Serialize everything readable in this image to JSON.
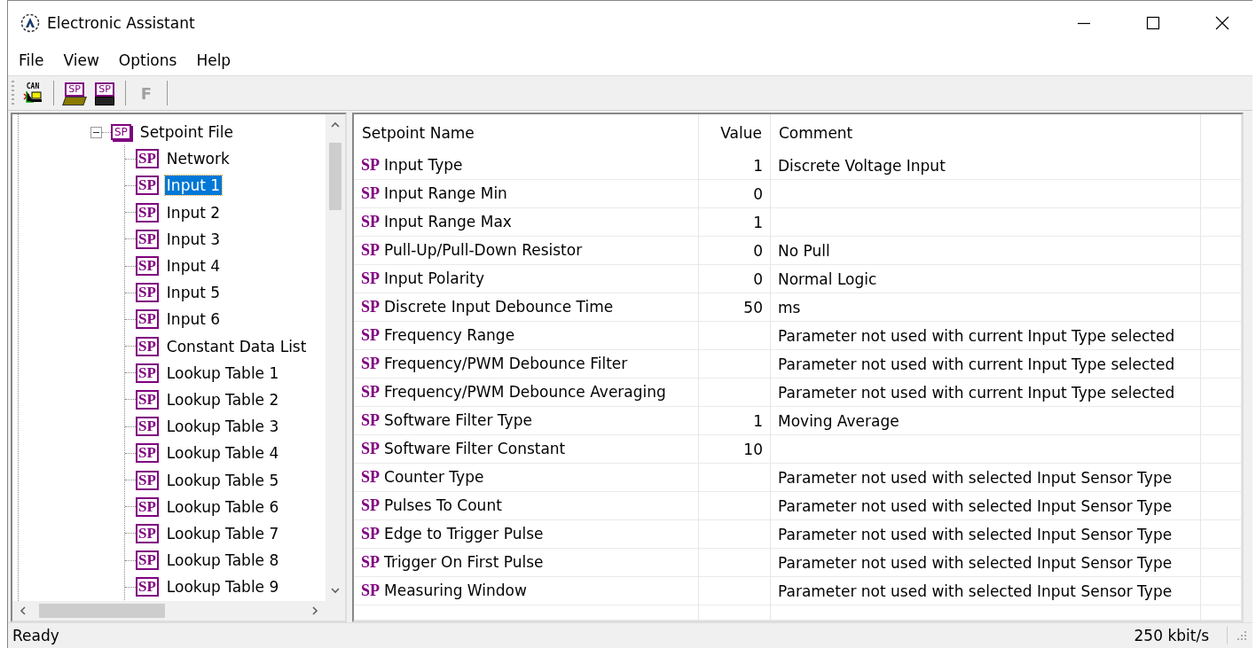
{
  "window": {
    "title": "Electronic Assistant"
  },
  "menu": [
    "File",
    "View",
    "Options",
    "Help"
  ],
  "toolbar": [
    {
      "kind": "can",
      "text": "CAN",
      "disabled": false
    },
    {
      "kind": "open",
      "text": "SP",
      "disabled": false
    },
    {
      "kind": "save",
      "text": "SP",
      "disabled": false
    },
    {
      "kind": "letter",
      "text": "F",
      "disabled": true
    }
  ],
  "tree": {
    "root": {
      "label": "Setpoint File",
      "icon_text": "SP",
      "expanded": true,
      "children": [
        {
          "label": "Network",
          "icon_text": "SP",
          "selected": false
        },
        {
          "label": "Input 1",
          "icon_text": "SP",
          "selected": true
        },
        {
          "label": "Input 2",
          "icon_text": "SP",
          "selected": false
        },
        {
          "label": "Input 3",
          "icon_text": "SP",
          "selected": false
        },
        {
          "label": "Input 4",
          "icon_text": "SP",
          "selected": false
        },
        {
          "label": "Input 5",
          "icon_text": "SP",
          "selected": false
        },
        {
          "label": "Input 6",
          "icon_text": "SP",
          "selected": false
        },
        {
          "label": "Constant Data List",
          "icon_text": "SP",
          "selected": false
        },
        {
          "label": "Lookup Table 1",
          "icon_text": "SP",
          "selected": false
        },
        {
          "label": "Lookup Table 2",
          "icon_text": "SP",
          "selected": false
        },
        {
          "label": "Lookup Table 3",
          "icon_text": "SP",
          "selected": false
        },
        {
          "label": "Lookup Table 4",
          "icon_text": "SP",
          "selected": false
        },
        {
          "label": "Lookup Table 5",
          "icon_text": "SP",
          "selected": false
        },
        {
          "label": "Lookup Table 6",
          "icon_text": "SP",
          "selected": false
        },
        {
          "label": "Lookup Table 7",
          "icon_text": "SP",
          "selected": false
        },
        {
          "label": "Lookup Table 8",
          "icon_text": "SP",
          "selected": false
        },
        {
          "label": "Lookup Table 9",
          "icon_text": "SP",
          "selected": false
        }
      ]
    }
  },
  "table": {
    "columns": [
      "Setpoint Name",
      "Value",
      "Comment"
    ],
    "rows": [
      {
        "icon_text": "SP",
        "name": "Input Type",
        "value": "1",
        "comment": "Discrete Voltage Input"
      },
      {
        "icon_text": "SP",
        "name": "Input Range Min",
        "value": "0",
        "comment": ""
      },
      {
        "icon_text": "SP",
        "name": "Input Range Max",
        "value": "1",
        "comment": ""
      },
      {
        "icon_text": "SP",
        "name": "Pull-Up/Pull-Down Resistor",
        "value": "0",
        "comment": "No Pull"
      },
      {
        "icon_text": "SP",
        "name": "Input Polarity",
        "value": "0",
        "comment": "Normal Logic"
      },
      {
        "icon_text": "SP",
        "name": "Discrete Input Debounce Time",
        "value": "50",
        "comment": "ms"
      },
      {
        "icon_text": "SP",
        "name": "Frequency Range",
        "value": "",
        "comment": "Parameter not used with current Input Type selected"
      },
      {
        "icon_text": "SP",
        "name": "Frequency/PWM Debounce Filter",
        "value": "",
        "comment": "Parameter not used with current Input Type selected"
      },
      {
        "icon_text": "SP",
        "name": "Frequency/PWM Debounce Averaging",
        "value": "",
        "comment": "Parameter not used with current Input Type selected"
      },
      {
        "icon_text": "SP",
        "name": "Software Filter Type",
        "value": "1",
        "comment": "Moving Average"
      },
      {
        "icon_text": "SP",
        "name": "Software Filter Constant",
        "value": "10",
        "comment": ""
      },
      {
        "icon_text": "SP",
        "name": "Counter Type",
        "value": "",
        "comment": "Parameter not used with selected Input Sensor Type"
      },
      {
        "icon_text": "SP",
        "name": "Pulses To Count",
        "value": "",
        "comment": "Parameter not used with selected Input Sensor Type"
      },
      {
        "icon_text": "SP",
        "name": "Edge to Trigger Pulse",
        "value": "",
        "comment": "Parameter not used with selected Input Sensor Type"
      },
      {
        "icon_text": "SP",
        "name": "Trigger On First Pulse",
        "value": "",
        "comment": "Parameter not used with selected Input Sensor Type"
      },
      {
        "icon_text": "SP",
        "name": "Measuring Window",
        "value": "",
        "comment": "Parameter not used with selected Input Sensor Type"
      }
    ]
  },
  "status_bar": {
    "message": "Ready",
    "baud": "250 kbit/s"
  }
}
